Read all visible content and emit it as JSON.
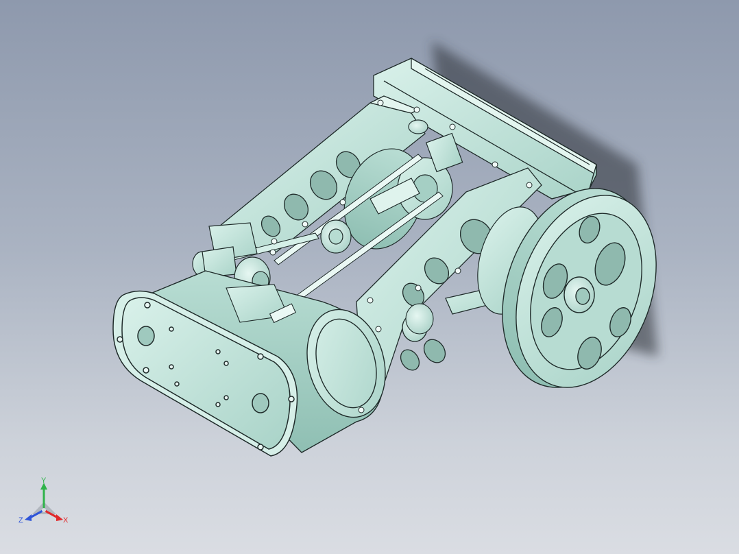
{
  "window": {
    "background_top": "#8e99ad",
    "background_bottom": "#dadde3"
  },
  "model": {
    "part_color": "#c7e8df",
    "edge_color": "#1f2b2a",
    "shadow_color": "#2b2f36"
  },
  "triad": {
    "x_label": "X",
    "y_label": "Y",
    "z_label": "Z",
    "x_color": "#e0292b",
    "y_color": "#2fb34a",
    "z_color": "#2f55d8",
    "icon": "coordinate-triad-icon"
  }
}
